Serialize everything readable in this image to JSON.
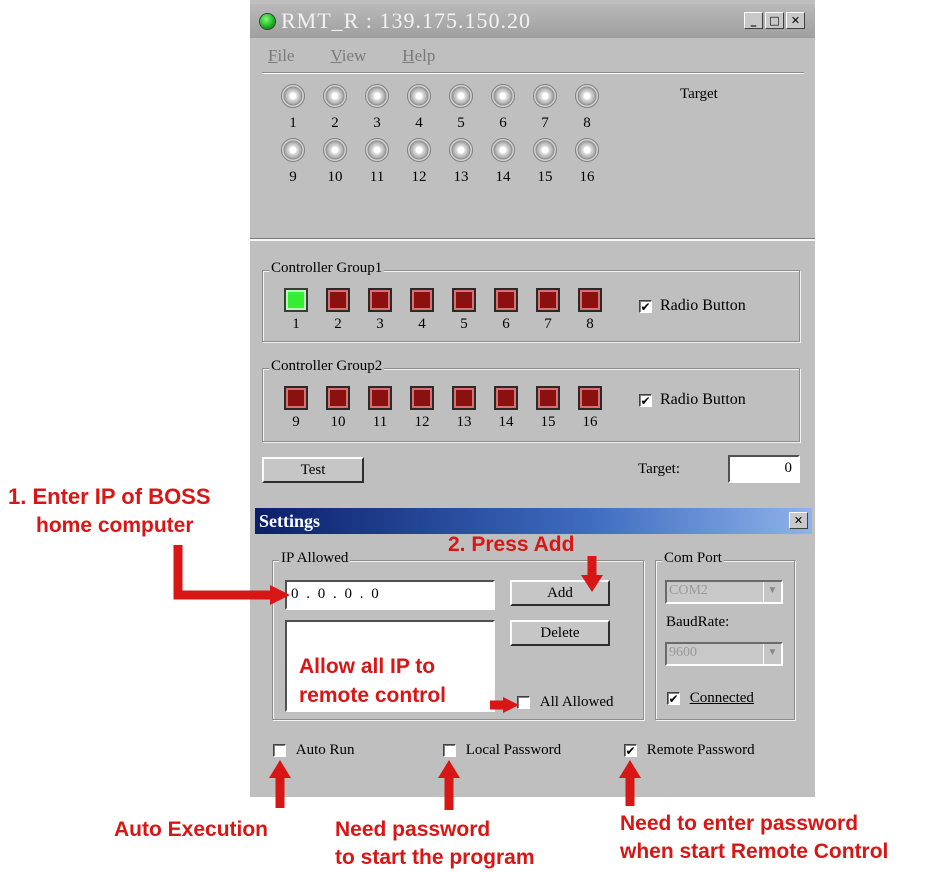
{
  "window": {
    "title": "RMT_R : 139.175.150.20",
    "controls": [
      "_",
      "□",
      "✕"
    ]
  },
  "menu": [
    "File",
    "View",
    "Help"
  ],
  "targets": {
    "title": "Target",
    "row1": [
      "1",
      "2",
      "3",
      "4",
      "5",
      "6",
      "7",
      "8"
    ],
    "row2": [
      "9",
      "10",
      "11",
      "12",
      "13",
      "14",
      "15",
      "16"
    ]
  },
  "group1": {
    "label": "Controller Group1",
    "numbers": [
      "1",
      "2",
      "3",
      "4",
      "5",
      "6",
      "7",
      "8"
    ],
    "active": [
      true,
      false,
      false,
      false,
      false,
      false,
      false,
      false
    ],
    "radio_label": "Radio Button",
    "radio_checked": true
  },
  "group2": {
    "label": "Controller Group2",
    "numbers": [
      "9",
      "10",
      "11",
      "12",
      "13",
      "14",
      "15",
      "16"
    ],
    "active": [
      false,
      false,
      false,
      false,
      false,
      false,
      false,
      false
    ],
    "radio_label": "Radio Button",
    "radio_checked": true
  },
  "test_button": "Test",
  "target_field": {
    "label": "Target:",
    "value": "0"
  },
  "settings": {
    "title": "Settings",
    "close": "✕",
    "ip_allowed": {
      "label": "IP Allowed",
      "ip_value": "0 . 0 . 0 . 0",
      "add_button": "Add",
      "delete_button": "Delete",
      "all_allowed_label": "All Allowed",
      "all_allowed_checked": false
    },
    "com_port": {
      "label": "Com Port",
      "value": "COM2",
      "baudrate_label": "BaudRate:",
      "baudrate_value": "9600",
      "connected_label": "Connected",
      "connected_checked": true
    },
    "auto_run": {
      "label": "Auto Run",
      "checked": false
    },
    "local_password": {
      "label": "Local Password",
      "checked": false
    },
    "remote_password": {
      "label": "Remote Password",
      "checked": true
    }
  },
  "annotations": {
    "step1_line1": "1. Enter IP of BOSS",
    "step1_line2": "home computer",
    "step2": "2. Press Add",
    "allow_line1": "Allow all IP to",
    "allow_line2": "remote control",
    "auto_exec": "Auto Execution",
    "need_pw_line1": "Need password",
    "need_pw_line2": "to start the program",
    "remote_pw_line1": "Need to enter password",
    "remote_pw_line2": "when start Remote Control"
  },
  "colors": {
    "annotation_red": "#d81616",
    "led_off": "#8b1010",
    "led_on": "#33ee33",
    "settings_titlebar": "#0a1f6b"
  }
}
